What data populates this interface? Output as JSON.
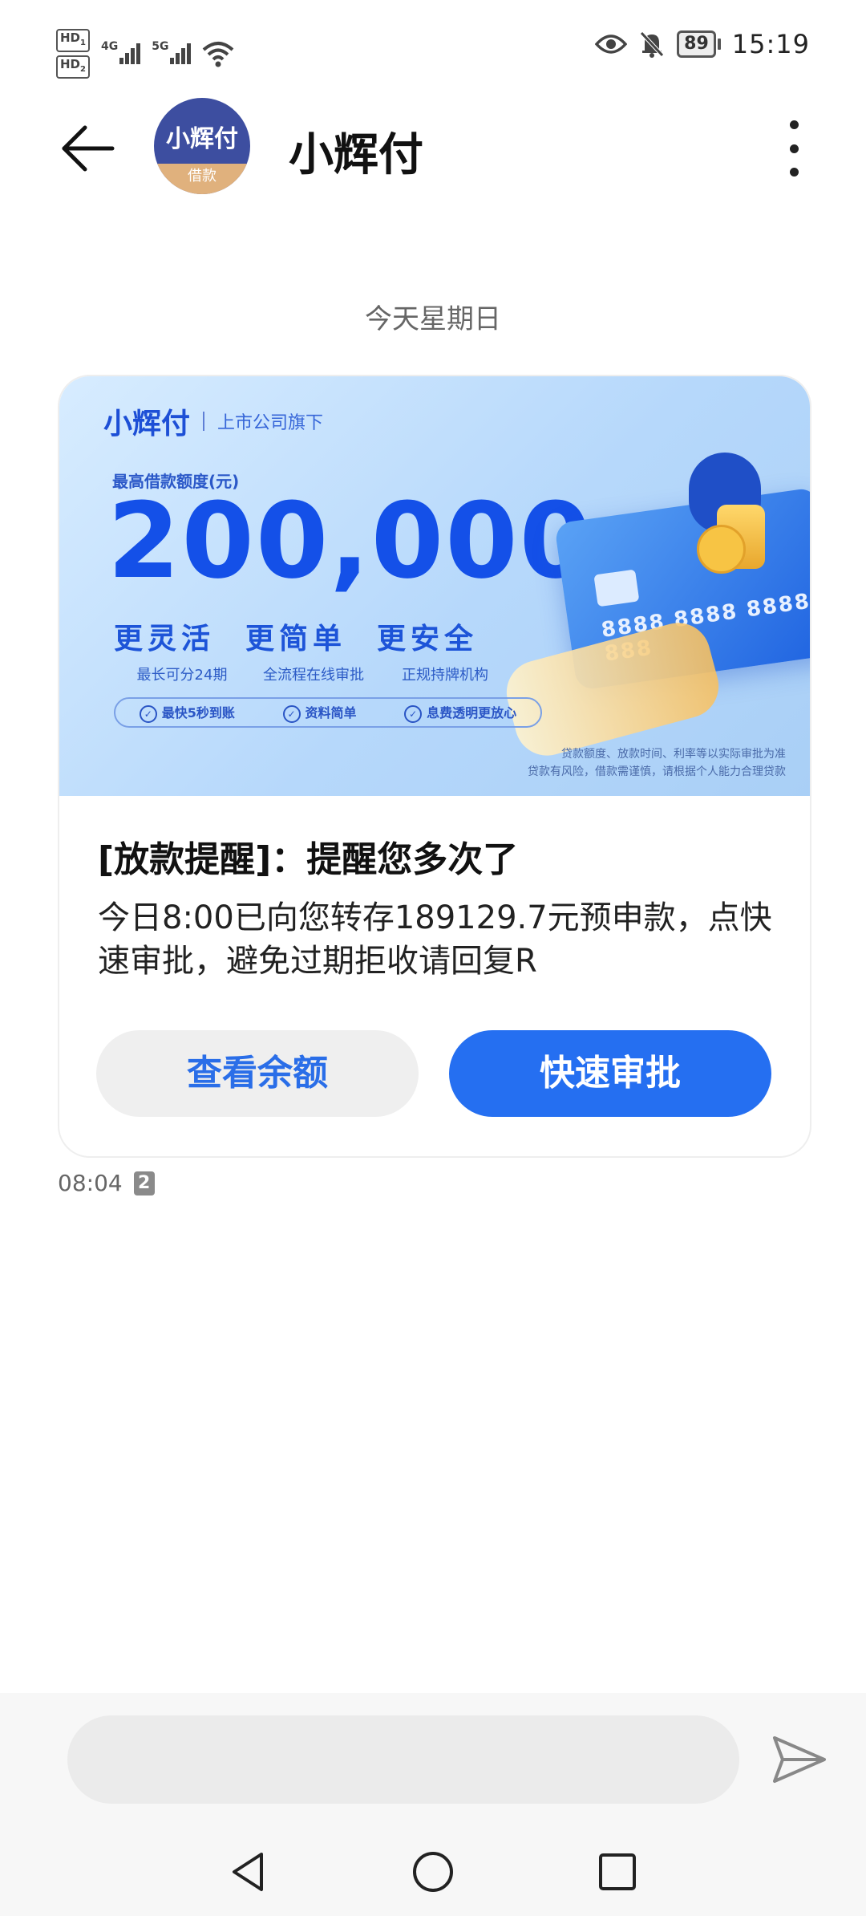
{
  "status_bar": {
    "hd1": "HD",
    "hd1_sub": "1",
    "hd2": "HD",
    "hd2_sub": "2",
    "net1": "4G",
    "net2": "5G",
    "battery": "89",
    "time": "15:19"
  },
  "header": {
    "avatar_top": "小辉付",
    "avatar_bottom": "借款",
    "title": "小辉付"
  },
  "date_label": "今天星期日",
  "banner": {
    "brand": "小辉付",
    "brand_tag": "上市公司旗下",
    "limit_label": "最高借款额度(元)",
    "amount": "200,000",
    "features": [
      {
        "title": "更灵活",
        "subtitle": "最长可分24期"
      },
      {
        "title": "更简单",
        "subtitle": "全流程在线审批"
      },
      {
        "title": "更安全",
        "subtitle": "正规持牌机构"
      }
    ],
    "chips": [
      "最快5秒到账",
      "资料简单",
      "息费透明更放心"
    ],
    "card_number": "8888 8888 8888 888",
    "disclaimer_line1": "贷款额度、放款时间、利率等以实际审批为准",
    "disclaimer_line2": "贷款有风险，借款需谨慎，请根据个人能力合理贷款"
  },
  "message": {
    "title": "[放款提醒]：提醒您多次了",
    "body": "今日8:00已向您转存189129.7元预申款，点快速审批，避免过期拒收请回复R",
    "btn_balance": "查看余额",
    "btn_approve": "快速审批",
    "time": "08:04",
    "sim": "2"
  },
  "input": {
    "placeholder": ""
  },
  "colors": {
    "accent": "#256ff1",
    "brand_blue": "#1450e8"
  }
}
